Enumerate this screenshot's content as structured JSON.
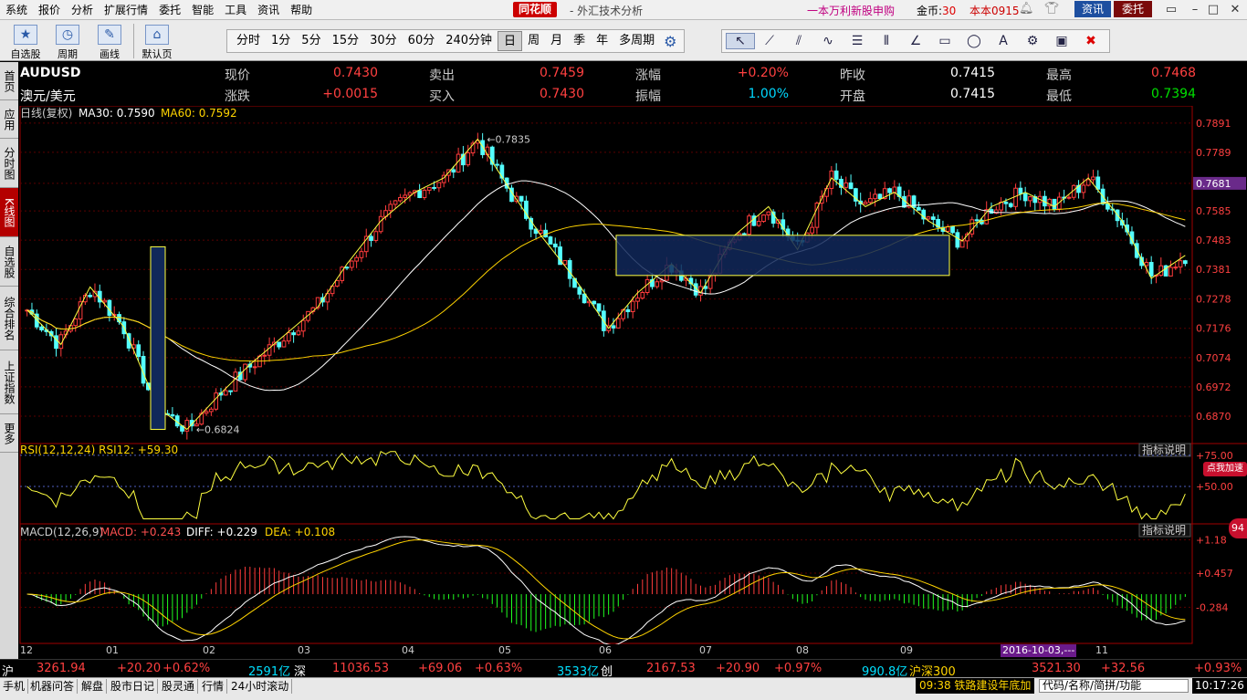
{
  "menubar": {
    "items": [
      "系统",
      "报价",
      "分析",
      "扩展行情",
      "委托",
      "智能",
      "工具",
      "资讯",
      "帮助"
    ],
    "logo": "同花顺",
    "app_title": "- 外汇技术分析",
    "news": "一本万利新股申购",
    "gold_label": "金币:",
    "gold_value": "30",
    "version": "本本0915",
    "btn_news": "资讯",
    "btn_trade": "委托"
  },
  "toolbar": {
    "big_buttons": [
      {
        "label": "自选股",
        "icon": "star-icon"
      },
      {
        "label": "周期",
        "icon": "cycle-icon"
      },
      {
        "label": "画线",
        "icon": "pen-icon"
      },
      {
        "label": "默认页",
        "icon": "home-icon"
      }
    ],
    "periods": [
      "分时",
      "1分",
      "5分",
      "15分",
      "30分",
      "60分",
      "240分钟",
      "日",
      "周",
      "月",
      "季",
      "年",
      "多周期"
    ],
    "selected_period": "日",
    "draw_tools": [
      "cursor-icon",
      "line-icon",
      "channel-icon",
      "wave-icon",
      "fib-icon",
      "parallel-icon",
      "angle-icon",
      "rect-icon",
      "ellipse-icon",
      "text-icon",
      "gear-icon",
      "save-icon",
      "delete-icon"
    ]
  },
  "leftnav": {
    "items": [
      "首页",
      "应用",
      "分时图",
      "K线图",
      "自选股",
      "综合排名",
      "上证指数",
      "更多"
    ],
    "active": "K线图"
  },
  "quote": {
    "code": "AUDUSD",
    "name": "澳元/美元",
    "fields": [
      {
        "label": "现价",
        "value": "0.7430",
        "color": "#ff4040"
      },
      {
        "label": "卖出",
        "value": "0.7459",
        "color": "#ff4040"
      },
      {
        "label": "涨幅",
        "value": "+0.20%",
        "color": "#ff4040"
      },
      {
        "label": "昨收",
        "value": "0.7415",
        "color": "#ffffff"
      },
      {
        "label": "最高",
        "value": "0.7468",
        "color": "#ff4040"
      },
      {
        "label": "涨跌",
        "value": "+0.0015",
        "color": "#ff4040"
      },
      {
        "label": "买入",
        "value": "0.7430",
        "color": "#ff4040"
      },
      {
        "label": "振幅",
        "value": "1.00%",
        "color": "#00d8ff"
      },
      {
        "label": "开盘",
        "value": "0.7415",
        "color": "#ffffff"
      },
      {
        "label": "最低",
        "value": "0.7394",
        "color": "#00e000"
      }
    ]
  },
  "indicators": {
    "kline_label": "日线(复权)",
    "ma30": "MA30: 0.7590",
    "ma60": "MA60: 0.7592",
    "rsi": "RSI(12,12,24)  RSI12: +59.30",
    "macd_name": "MACD(12,26,9)",
    "macd": "MACD: +0.243",
    "diff": "DIFF: +0.229",
    "dea": "DEA: +0.108",
    "explain": "指标说明",
    "high_mark": "0.7835",
    "low_mark": "0.6824",
    "date_tag": "2016-10-03,---",
    "accel_badge": "点我加速",
    "side_badge": "94"
  },
  "chart_data": {
    "type": "candlestick",
    "price_ticks": [
      "0.7891",
      "0.7789",
      "0.7681",
      "0.7585",
      "0.7483",
      "0.7381",
      "0.7278",
      "0.7176",
      "0.7074",
      "0.6972",
      "0.6870"
    ],
    "price_range": [
      0.68,
      0.79
    ],
    "rsi_ticks": [
      "+75.00",
      "+50.00"
    ],
    "macd_ticks": [
      "+1.18",
      "+0.457",
      "-0.284"
    ],
    "x_labels": [
      "12",
      "01",
      "02",
      "03",
      "04",
      "05",
      "06",
      "07",
      "08",
      "09",
      "11"
    ],
    "closes": [
      0.724,
      0.712,
      0.732,
      0.718,
      0.69,
      0.6824,
      0.695,
      0.705,
      0.715,
      0.725,
      0.74,
      0.755,
      0.765,
      0.77,
      0.7835,
      0.765,
      0.75,
      0.735,
      0.7176,
      0.73,
      0.74,
      0.73,
      0.75,
      0.76,
      0.745,
      0.77,
      0.76,
      0.765,
      0.755,
      0.748,
      0.76,
      0.765,
      0.76,
      0.77,
      0.755,
      0.735,
      0.743
    ]
  },
  "statusbar": {
    "sh_label": "沪",
    "sh_value": "3261.94",
    "sh_chg": "+20.20",
    "sh_pct": "+0.62%",
    "sh_amt": "2591亿",
    "sz_label": "深",
    "sz_value": "11036.53",
    "sz_chg": "+69.06",
    "sz_pct": "+0.63%",
    "sz_amt": "3533亿",
    "cy_label": "创",
    "cy_value": "2167.53",
    "cy_chg": "+20.90",
    "cy_pct": "+0.97%",
    "cy_amt": "990.8亿",
    "hs_label": "沪深300",
    "hs_value": "3521.30",
    "hs_chg": "+32.56",
    "hs_pct": "+0.93%"
  },
  "bottombar": {
    "tabs": [
      "手机",
      "机器问答",
      "解盘",
      "股市日记",
      "股灵通",
      "行情",
      "24小时滚动"
    ],
    "scroll_news": "09:38 铁路建设年底加",
    "search_placeholder": "代码/名称/简拼/功能",
    "clock": "10:17:26"
  }
}
